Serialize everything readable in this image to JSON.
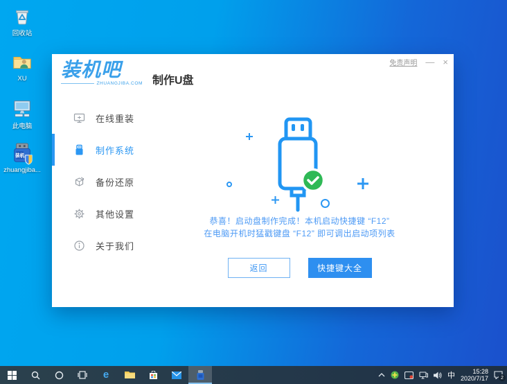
{
  "colors": {
    "accent_blue": "#2b97f3",
    "logo_blue": "#3aa0ea",
    "message_blue": "#4d9af5",
    "success_green": "#2fb956",
    "desktop_gradient_start": "#00a7f0",
    "desktop_gradient_end": "#1b50cc",
    "taskbar_bg": "#24384a"
  },
  "desktop": {
    "icons": [
      {
        "label": "回收站",
        "icon": "recycle-bin-icon"
      },
      {
        "label": "XU",
        "icon": "user-folder-icon"
      },
      {
        "label": "此电脑",
        "icon": "this-pc-icon"
      },
      {
        "label": "zhuangjiba...",
        "icon": "zhuangjiba-usb-icon"
      }
    ]
  },
  "window": {
    "logo": {
      "text": "装机吧",
      "subtext": "ZHUANGJIBA.COM"
    },
    "page_title": "制作U盘",
    "titlebar": {
      "disclaimer": "免责声明",
      "minimize": "—",
      "close": "×"
    },
    "sidebar": {
      "items": [
        {
          "label": "在线重装",
          "icon": "online-reinstall-icon",
          "active": false
        },
        {
          "label": "制作系统",
          "icon": "make-system-icon",
          "active": true
        },
        {
          "label": "备份还原",
          "icon": "backup-restore-icon",
          "active": false
        },
        {
          "label": "其他设置",
          "icon": "other-settings-icon",
          "active": false
        },
        {
          "label": "关于我们",
          "icon": "about-us-icon",
          "active": false
        }
      ]
    },
    "main": {
      "illustration": "usb-drive-with-green-check",
      "message_line1": "恭喜！启动盘制作完成！本机启动快捷键 “F12”",
      "message_line2": "在电脑开机时猛戳键盘 “F12” 即可调出启动项列表",
      "back_button": "返回",
      "hotkey_button": "快捷键大全"
    }
  },
  "taskbar": {
    "items": [
      "start-icon",
      "search-icon",
      "cortana-icon",
      "task-view-icon",
      "edge-icon",
      "file-explorer-icon",
      "store-icon",
      "mail-icon",
      "zhuangjiba-icon"
    ],
    "active_item": "zhuangjiba-icon",
    "edge_glyph": "e",
    "tray": {
      "icons": [
        "hidden-icons-chevron",
        "antivirus-icon",
        "screen-capture-icon",
        "network-icon",
        "volume-icon"
      ],
      "ime": "中",
      "time": "15:28",
      "date": "2020/7/17",
      "notification_badge": "2"
    }
  }
}
